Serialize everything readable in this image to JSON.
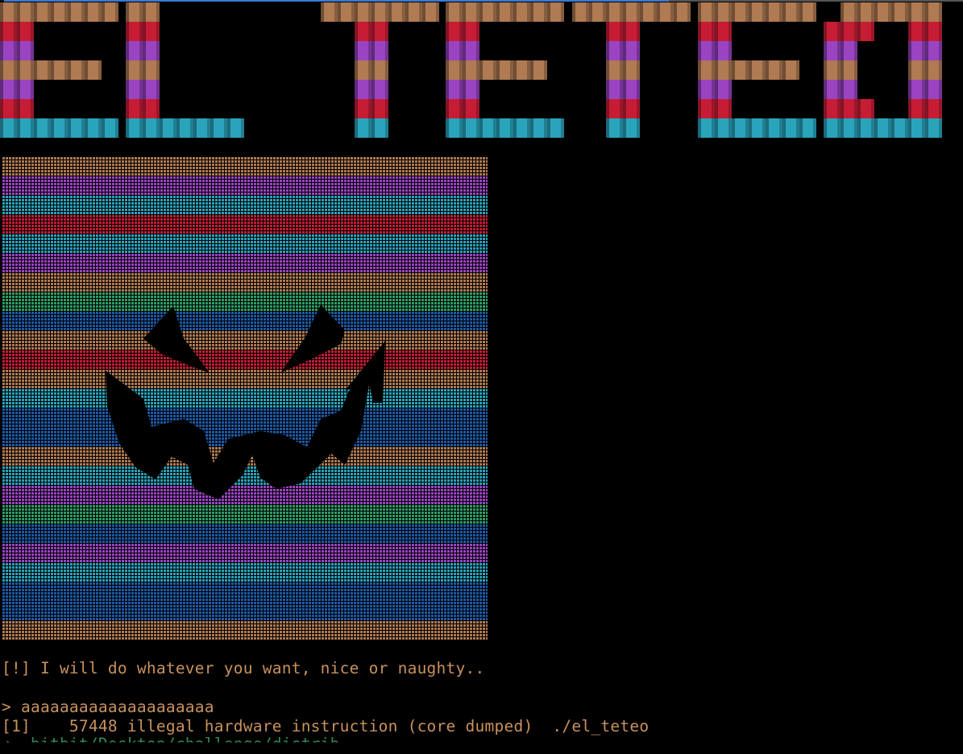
{
  "banner": {
    "text": "EL TETEO",
    "rows": [
      {
        "color": "#b07a52",
        "dark": "#3d2a1d"
      },
      {
        "color": "#c61d35",
        "dark": "#4a0c15"
      },
      {
        "color": "#9a44c2",
        "dark": "#321543"
      },
      {
        "color": "#b07a52",
        "dark": "#3d2a1d"
      },
      {
        "color": "#9a44c2",
        "dark": "#321543"
      },
      {
        "color": "#c61d35",
        "dark": "#4a0c15"
      },
      {
        "color": "#2aa4bb",
        "dark": "#0e3d48"
      }
    ]
  },
  "art": {
    "background": "#000000",
    "stripe_colors": [
      "#b07a52",
      "#9a44c2",
      "#2aa4bb",
      "#c61d35",
      "#2aa4bb",
      "#9a44c2",
      "#b07a52",
      "#2e9e66",
      "#1e5aa6",
      "#b07a52",
      "#c61d35",
      "#b07a52",
      "#2aa4bb",
      "#1e5aa6",
      "#1e5aa6",
      "#b07a52",
      "#2aa4bb",
      "#9a44c2",
      "#2e9e66",
      "#1e5aa6",
      "#9a44c2",
      "#2aa4bb",
      "#1e5aa6",
      "#1e5aa6",
      "#b07a52"
    ],
    "face_color": "#000000"
  },
  "terminal": {
    "text_color": "#c8915e",
    "accent_color": "#3a7bd5",
    "lines": [
      "[!] I will do whatever you want, nice or naughty..",
      "> aaaaaaaaaaaaaaaaaaaa",
      "[1]    57448 illegal hardware instruction (core dumped)  ./el_teteo"
    ],
    "partial_line": "➜  bitbit/Desktop/challenge/distrib"
  }
}
